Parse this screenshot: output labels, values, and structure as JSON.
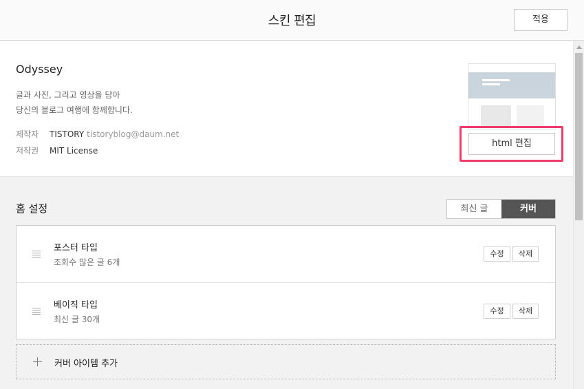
{
  "header": {
    "title": "스킨 편집",
    "apply_label": "적용"
  },
  "skin": {
    "name": "Odyssey",
    "desc_line1": "글과 사진, 그리고 영상을 담아",
    "desc_line2": "당신의 블로그 여행에 함께합니다.",
    "maker_key": "제작자",
    "maker_value": "TISTORY",
    "maker_email": "tistoryblog@daum.net",
    "license_key": "저작권",
    "license_value": "MIT License",
    "html_edit_label": "html 편집"
  },
  "home": {
    "title": "홈 설정",
    "tabs": [
      {
        "label": "최신 글",
        "active": false
      },
      {
        "label": "커버",
        "active": true
      }
    ],
    "items": [
      {
        "title": "포스터 타입",
        "sub": "조회수 많은 글 6개",
        "edit": "수정",
        "delete": "삭제"
      },
      {
        "title": "베이직 타입",
        "sub": "최신 글 30개",
        "edit": "수정",
        "delete": "삭제"
      }
    ],
    "add_label": "커버 아이템 추가"
  },
  "colors": {
    "highlight": "#ef3b6a",
    "active_tab": "#555555"
  }
}
